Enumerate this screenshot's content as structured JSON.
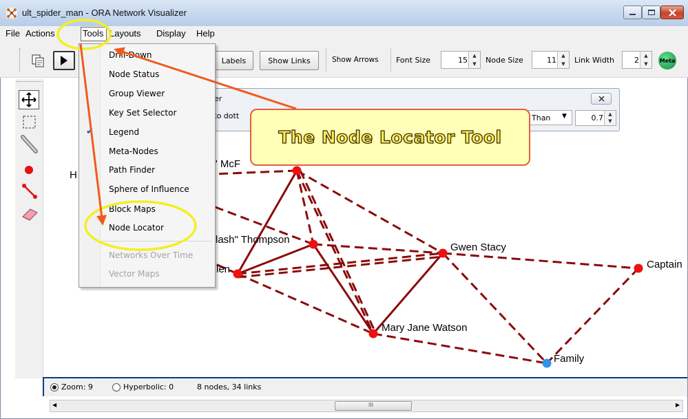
{
  "window": {
    "title": "ult_spider_man - ORA Network Visualizer"
  },
  "menubar": {
    "items": [
      "File",
      "Actions",
      "Tools",
      "Layouts",
      "Display",
      "Help"
    ]
  },
  "toolbar": {
    "labels_button": "Labels",
    "show_links_button": "Show Links",
    "show_arrows_label": "Show Arrows",
    "font_size_label": "Font Size",
    "font_size_value": "15",
    "node_size_label": "Node Size",
    "node_size_value": "11",
    "link_width_label": "Link Width",
    "link_width_value": "2",
    "meta_label": "Meta"
  },
  "tools_menu": {
    "items": [
      {
        "label": "Drill-Down",
        "enabled": true,
        "checked": false
      },
      {
        "label": "Node Status",
        "enabled": true,
        "checked": false
      },
      {
        "label": "Group Viewer",
        "enabled": true,
        "checked": false
      },
      {
        "label": "Key Set Selector",
        "enabled": true,
        "checked": false
      },
      {
        "label": "Legend",
        "enabled": true,
        "checked": true
      },
      {
        "label": "Meta-Nodes",
        "enabled": true,
        "checked": false
      },
      {
        "label": "Path Finder",
        "enabled": true,
        "checked": false
      },
      {
        "label": "Sphere of Influence",
        "enabled": true,
        "checked": false
      },
      {
        "label": "Block Maps",
        "enabled": true,
        "checked": false
      },
      {
        "label": "Node Locator",
        "enabled": true,
        "checked": false
      },
      {
        "label": "Networks Over Time",
        "enabled": false,
        "checked": false
      },
      {
        "label": "Vector Maps",
        "enabled": false,
        "checked": false
      }
    ]
  },
  "panel": {
    "title_fragment": "er",
    "text_fragment": "e to dott",
    "select_value": "Than",
    "threshold_value": "0.7"
  },
  "callout": {
    "text": "The Node Locator Tool"
  },
  "nodes": {
    "mcf": "g\" McF",
    "h": "H",
    "thompson": "lash\" Thompson",
    "gwen": "Gwen Stacy",
    "len": "len",
    "captain": "Captain",
    "mary_jane": "Mary Jane Watson",
    "family": "Family"
  },
  "colors": {
    "node": "#ee1111",
    "family_node": "#2f93e8",
    "link": "#8b0a0a",
    "arrow": "#ef5a1e",
    "highlight": "#f3ef22"
  },
  "status": {
    "zoom": "Zoom: 9",
    "hyperbolic": "Hyperbolic: 0",
    "counts": "8 nodes, 34 links"
  }
}
